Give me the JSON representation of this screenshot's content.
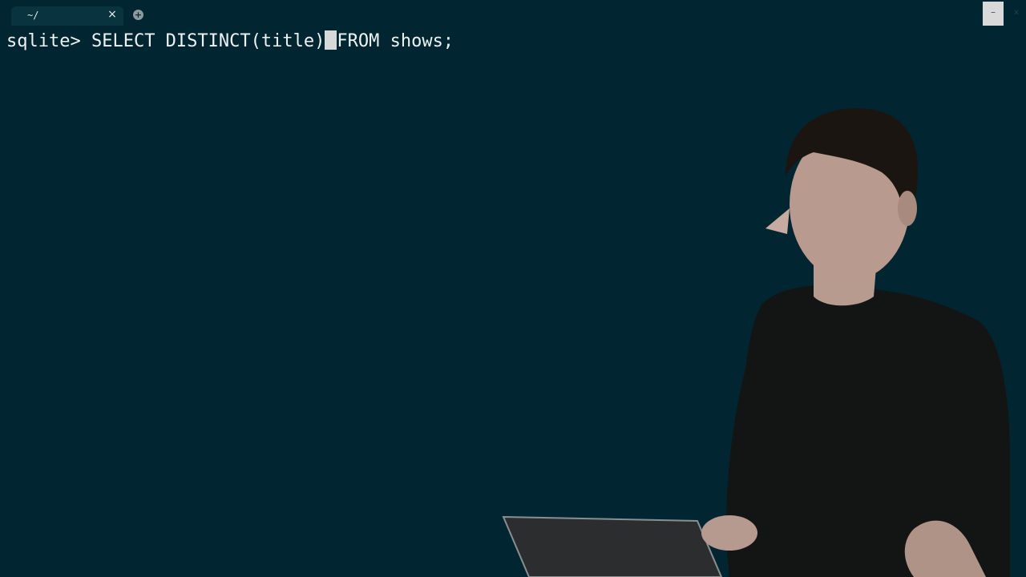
{
  "tab": {
    "title": "~/",
    "close_label": "×"
  },
  "new_tab": {
    "label": "+"
  },
  "window": {
    "button_label": "–",
    "button2_label": "x"
  },
  "terminal": {
    "prompt": "sqlite>",
    "command_before_cursor": " SELECT DISTINCT(title)",
    "command_after_cursor": "FROM shows;"
  },
  "colors": {
    "background": "#012632",
    "text": "#eef2f2",
    "cursor": "#d6d9d9"
  },
  "icons": {
    "close": "close-icon",
    "new_tab": "plus-icon",
    "cursor": "block-cursor"
  }
}
